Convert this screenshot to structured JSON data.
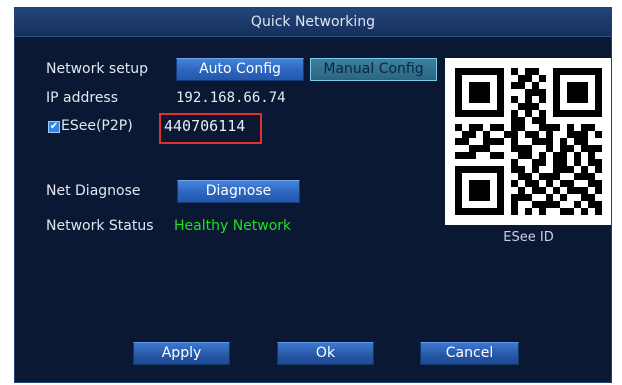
{
  "window": {
    "title": "Quick Networking"
  },
  "network_setup": {
    "label": "Network setup",
    "auto_config_label": "Auto Config",
    "manual_config_label": "Manual Config"
  },
  "ip": {
    "label": "IP address",
    "value": "192.168.66.74"
  },
  "p2p": {
    "checked": true,
    "label": "ESee(P2P)",
    "id_value": "440706114"
  },
  "diagnose": {
    "label": "Net Diagnose",
    "button_label": "Diagnose"
  },
  "status": {
    "label": "Network Status",
    "value": "Healthy Network"
  },
  "qr": {
    "caption": "ESee ID"
  },
  "footer": {
    "apply_label": "Apply",
    "ok_label": "Ok",
    "cancel_label": "Cancel"
  },
  "icons": {
    "checkbox": "checkbox-checked-icon",
    "qr": "qr-code-icon"
  },
  "colors": {
    "background": "#0b1834",
    "title_bar": "#1c3a6b",
    "button": "#2c65be",
    "status_ok": "#1fe01f",
    "highlight": "#e2312b",
    "checkbox": "#2f88ea"
  }
}
